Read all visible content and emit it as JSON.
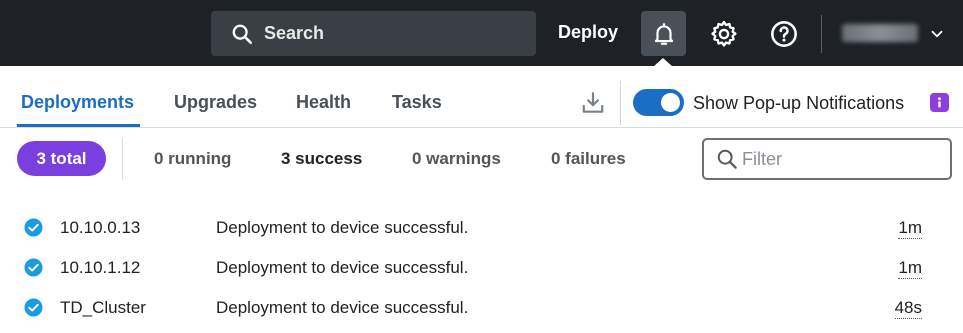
{
  "topbar": {
    "search_label": "Search",
    "deploy_label": "Deploy",
    "user_name": "",
    "icons": [
      "search-icon",
      "bell-icon",
      "gear-icon",
      "help-icon",
      "chevron-down-icon"
    ]
  },
  "tabs": [
    {
      "label": "Deployments",
      "active": true
    },
    {
      "label": "Upgrades",
      "active": false
    },
    {
      "label": "Health",
      "active": false
    },
    {
      "label": "Tasks",
      "active": false
    }
  ],
  "popup_toggle": {
    "label": "Show Pop-up Notifications",
    "enabled": true
  },
  "filters": {
    "total": "3 total",
    "running": "0 running",
    "success": "3 success",
    "warnings": "0 warnings",
    "failures": "0 failures",
    "search_placeholder": "Filter",
    "search_value": ""
  },
  "deployments": [
    {
      "device": "10.10.0.13",
      "message": "Deployment to device successful.",
      "time": "1m",
      "status": "success"
    },
    {
      "device": "10.10.1.12",
      "message": "Deployment to device successful.",
      "time": "1m",
      "status": "success"
    },
    {
      "device": "TD_Cluster",
      "message": "Deployment to device successful.",
      "time": "48s",
      "status": "success"
    }
  ],
  "colors": {
    "topbar_bg": "#1e2227",
    "accent": "#1b6ec2",
    "total_pill": "#7b3fe0",
    "info_badge": "#8c3fdb",
    "success_icon": "#1b9be0"
  }
}
